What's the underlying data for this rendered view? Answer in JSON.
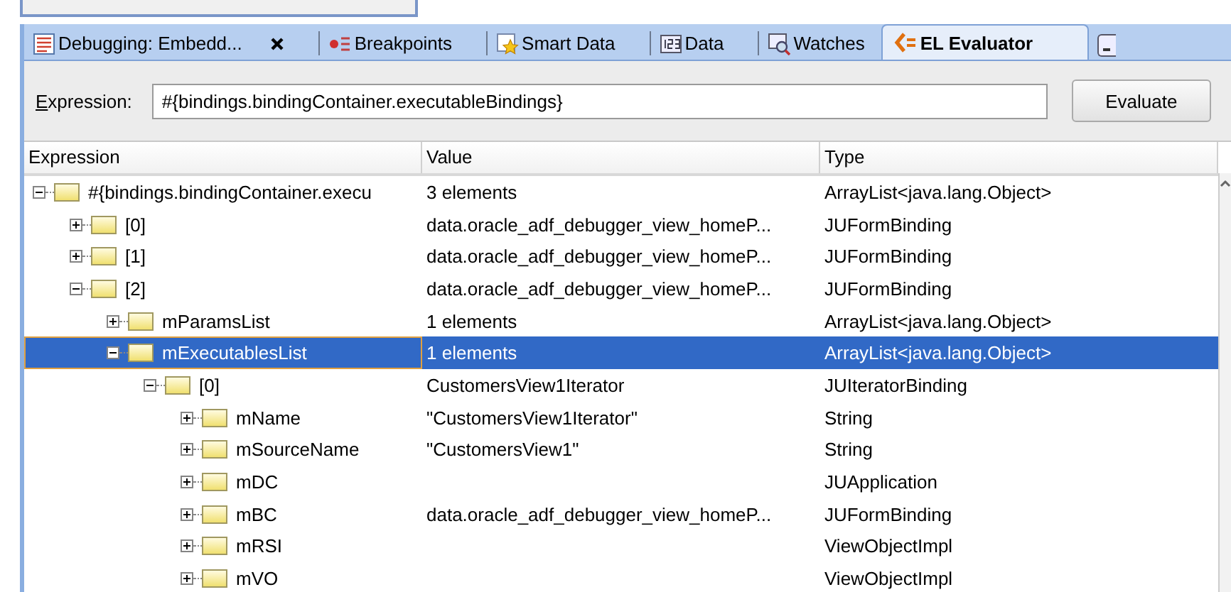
{
  "tabs": [
    {
      "label": "Debugging: Embedd...",
      "kind": "log",
      "closable": true,
      "selected": false
    },
    {
      "label": "Breakpoints",
      "kind": "breakpoints",
      "closable": false,
      "selected": false
    },
    {
      "label": "Smart Data",
      "kind": "smart",
      "closable": false,
      "selected": false
    },
    {
      "label": "Data",
      "kind": "data",
      "closable": false,
      "selected": false
    },
    {
      "label": "Watches",
      "kind": "watches",
      "closable": false,
      "selected": false
    },
    {
      "label": "EL Evaluator",
      "kind": "el",
      "closable": false,
      "selected": true
    }
  ],
  "expression": {
    "label": "Expression:",
    "value": "#{bindings.bindingContainer.executableBindings}",
    "button": "Evaluate"
  },
  "table": {
    "columns": [
      "Expression",
      "Value",
      "Type"
    ],
    "rows": [
      {
        "expression": "#{bindings.bindingContainer.execu",
        "value": "3 elements",
        "type": "ArrayList<java.lang.Object>",
        "expanded": true,
        "selected": false,
        "children": [
          {
            "expression": "[0]",
            "value": "data.oracle_adf_debugger_view_homeP...",
            "type": "JUFormBinding",
            "expanded": false,
            "selected": false
          },
          {
            "expression": "[1]",
            "value": "data.oracle_adf_debugger_view_homeP...",
            "type": "JUFormBinding",
            "expanded": false,
            "selected": false
          },
          {
            "expression": "[2]",
            "value": "data.oracle_adf_debugger_view_homeP...",
            "type": "JUFormBinding",
            "expanded": true,
            "selected": false,
            "children": [
              {
                "expression": "mParamsList",
                "value": "1 elements",
                "type": "ArrayList<java.lang.Object>",
                "expanded": false,
                "selected": false
              },
              {
                "expression": "mExecutablesList",
                "value": "1 elements",
                "type": "ArrayList<java.lang.Object>",
                "expanded": true,
                "selected": true,
                "children": [
                  {
                    "expression": "[0]",
                    "value": "CustomersView1Iterator",
                    "type": "JUIteratorBinding",
                    "expanded": true,
                    "selected": false,
                    "children": [
                      {
                        "expression": "mName",
                        "value": "\"CustomersView1Iterator\"",
                        "type": "String",
                        "expanded": false,
                        "selected": false
                      },
                      {
                        "expression": "mSourceName",
                        "value": "\"CustomersView1\"",
                        "type": "String",
                        "expanded": false,
                        "selected": false
                      },
                      {
                        "expression": "mDC",
                        "type": "JUApplication",
                        "expanded": false,
                        "selected": false
                      },
                      {
                        "expression": "mBC",
                        "value": "data.oracle_adf_debugger_view_homeP...",
                        "type": "JUFormBinding",
                        "expanded": false,
                        "selected": false
                      },
                      {
                        "expression": "mRSI",
                        "type": "ViewObjectImpl",
                        "expanded": false,
                        "selected": false
                      },
                      {
                        "expression": "mVO",
                        "type": "ViewObjectImpl",
                        "expanded": false,
                        "selected": false
                      }
                    ]
                  }
                ]
              }
            ]
          }
        ]
      }
    ]
  }
}
